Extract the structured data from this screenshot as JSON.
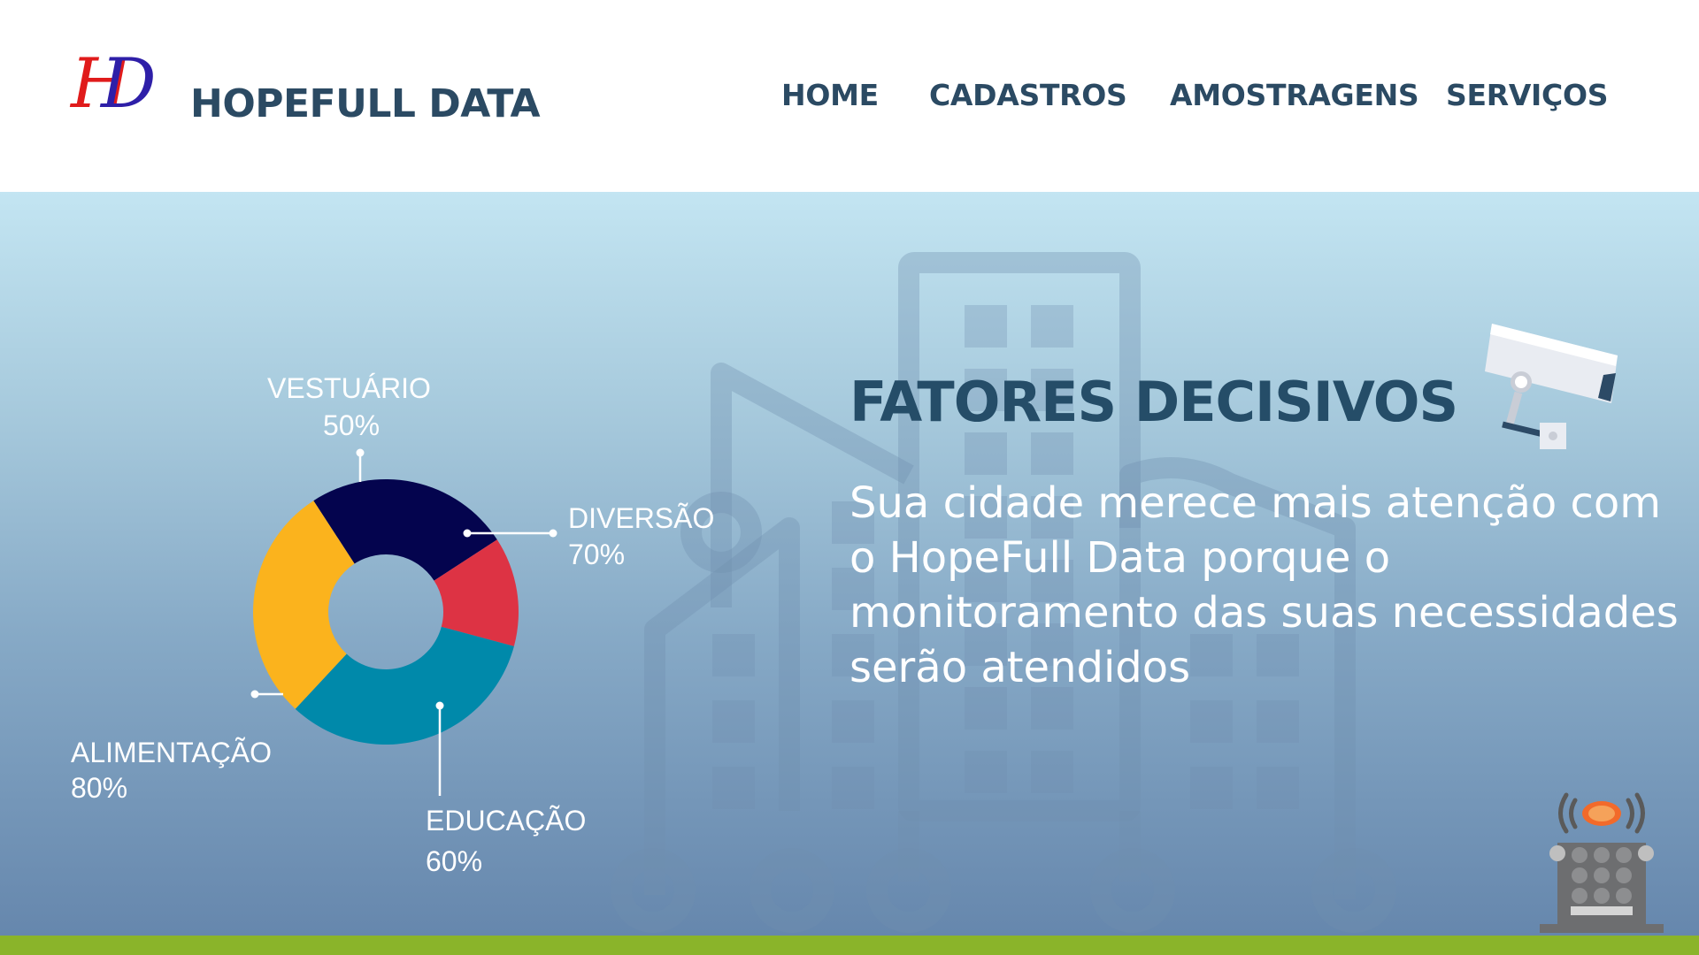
{
  "brand": {
    "logo_letters": [
      "H",
      "D"
    ],
    "name": "HOPEFULL DATA"
  },
  "nav": {
    "home": "HOME",
    "cadastros": "CADASTROS",
    "amostragens": "AMOSTRAGENS",
    "servicos": "SERVIÇOS"
  },
  "hero": {
    "headline": "FATORES DECISIVOS",
    "body": "Sua cidade merece mais atenção com o HopeFull Data porque o monitoramento das suas necessidades serão atendidos"
  },
  "colors": {
    "brand_text": "#2b4a63",
    "headline": "#254d68",
    "accent_green": "#8ab42a",
    "logo_red": "#e01b1b",
    "logo_blue": "#2e1fa8"
  },
  "icons": [
    "security-camera-icon",
    "sensor-device-icon"
  ],
  "chart_data": {
    "type": "pie",
    "title": "",
    "slices": [
      {
        "label": "VESTUÁRIO",
        "value_label": "50%",
        "value": 50,
        "color": "#04044e"
      },
      {
        "label": "DIVERSÃO",
        "value_label": "70%",
        "value": 70,
        "color": "#dd3344"
      },
      {
        "label": "EDUCAÇÃO",
        "value_label": "60%",
        "value": 60,
        "color": "#0089aa"
      },
      {
        "label": "ALIMENTAÇÃO",
        "value_label": "80%",
        "value": 80,
        "color": "#fbb31d"
      }
    ]
  }
}
